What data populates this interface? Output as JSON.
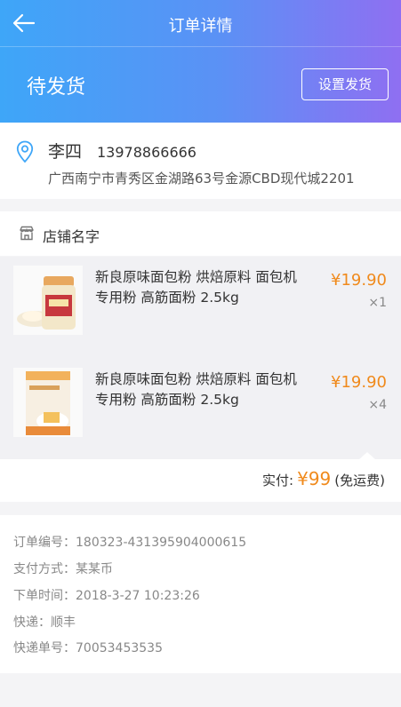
{
  "nav": {
    "title": "订单详情",
    "back_icon": "arrow-left-icon"
  },
  "status": {
    "text": "待发货",
    "action_label": "设置发货"
  },
  "colors": {
    "gradient_start": "#3ea6f8",
    "gradient_end": "#8f6ff2",
    "accent": "#f08a1c",
    "pin": "#3ea6f8"
  },
  "address": {
    "icon": "location-pin-icon",
    "name": "李四",
    "phone": "13978866666",
    "line": "广西南宁市青秀区金湖路63号金源CBD现代城2201"
  },
  "shop": {
    "icon": "store-icon",
    "name": "店铺名字"
  },
  "items": [
    {
      "title": "新良原味面包粉 烘焙原料 面包机专用粉 高筋面粉 2.5kg",
      "price": "¥19.90",
      "qty": "×1"
    },
    {
      "title": "新良原味面包粉 烘焙原料 面包机专用粉 高筋面粉 2.5kg",
      "price": "¥19.90",
      "qty": "×4"
    }
  ],
  "payment": {
    "label": "实付:",
    "amount": "¥99",
    "note": "(免运费)"
  },
  "info": [
    "订单编号：180323-431395904000615",
    "支付方式：某某币",
    "下单时间：2018-3-27 10:23:26",
    "快递：顺丰",
    "快递单号：70053453535"
  ]
}
